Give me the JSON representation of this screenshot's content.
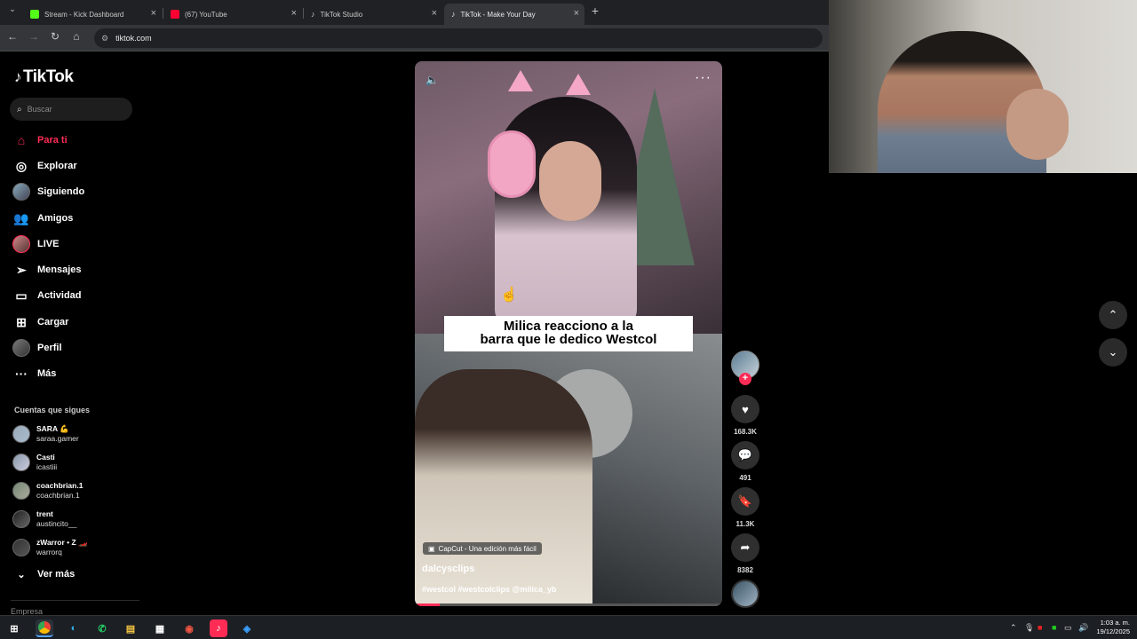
{
  "browser": {
    "tabs": [
      {
        "title": "Stream - Kick Dashboard",
        "color": "#53fc18"
      },
      {
        "title": "(67) YouTube",
        "color": "#ff0033"
      },
      {
        "title": "TikTok Studio",
        "color": "#ffffff"
      },
      {
        "title": "TikTok - Make Your Day",
        "color": "#ffffff"
      }
    ],
    "new_tab": "+",
    "url": "tiktok.com"
  },
  "sidebar": {
    "logo": "TikTok",
    "search_placeholder": "Buscar",
    "nav": [
      {
        "label": "Para ti",
        "icon": "home-icon"
      },
      {
        "label": "Explorar",
        "icon": "compass-icon"
      },
      {
        "label": "Siguiendo",
        "icon": "following-avatar-icon"
      },
      {
        "label": "Amigos",
        "icon": "friends-icon"
      },
      {
        "label": "LIVE",
        "icon": "live-avatar-icon"
      },
      {
        "label": "Mensajes",
        "icon": "send-icon"
      },
      {
        "label": "Actividad",
        "icon": "activity-icon"
      },
      {
        "label": "Cargar",
        "icon": "upload-icon"
      },
      {
        "label": "Perfil",
        "icon": "profile-avatar-icon"
      },
      {
        "label": "Más",
        "icon": "more-icon"
      }
    ],
    "following_header": "Cuentas que sigues",
    "following": [
      {
        "name": "SARA 💪",
        "handle": "saraa.gamer"
      },
      {
        "name": "Casti",
        "handle": "icastiii"
      },
      {
        "name": "coachbrian.1",
        "handle": "coachbrian.1"
      },
      {
        "name": "trent",
        "handle": "austincito__"
      },
      {
        "name": "zWarror • Z 🏎️",
        "handle": "warrorq"
      }
    ],
    "see_more": "Ver más",
    "footer": "Empresa"
  },
  "video": {
    "caption_line1": "Milica reacciono a la",
    "caption_line2": "barra que le dedico Westcol",
    "capcut_label": "CapCut - Una edición más fácil",
    "author": "dalcysclips",
    "tags": "#westcol #westcolclips @milica_yb",
    "progress": 0.08
  },
  "actions": {
    "likes": "168.3K",
    "comments": "491",
    "saves": "11.3K",
    "shares": "8382"
  },
  "taskbar": {
    "time": "1:03 a. m.",
    "date": "19/12/2025"
  },
  "colors": {
    "accent": "#fe2c55",
    "background": "#000000"
  }
}
